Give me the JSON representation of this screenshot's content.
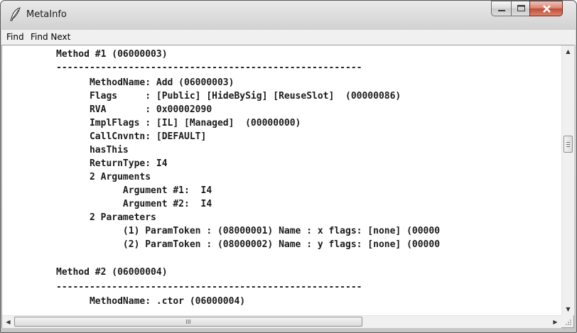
{
  "window": {
    "title": "MetaInfo"
  },
  "menu": {
    "items": [
      "Find",
      "Find Next"
    ]
  },
  "content": {
    "lines": [
      "Method #1 (06000003)",
      "-------------------------------------------------------",
      "      MethodName: Add (06000003)",
      "      Flags     : [Public] [HideBySig] [ReuseSlot]  (00000086)",
      "      RVA       : 0x00002090",
      "      ImplFlags : [IL] [Managed]  (00000000)",
      "      CallCnvntn: [DEFAULT]",
      "      hasThis",
      "      ReturnType: I4",
      "      2 Arguments",
      "            Argument #1:  I4",
      "            Argument #2:  I4",
      "      2 Parameters",
      "            (1) ParamToken : (08000001) Name : x flags: [none] (00000",
      "            (2) ParamToken : (08000002) Name : y flags: [none] (00000",
      "",
      "Method #2 (06000004)",
      "-------------------------------------------------------",
      "      MethodName: .ctor (06000004)"
    ]
  },
  "scrollbars": {
    "horizontal_thumb_glyph": "III",
    "vertical_thumb_icon": "grip-icon"
  }
}
